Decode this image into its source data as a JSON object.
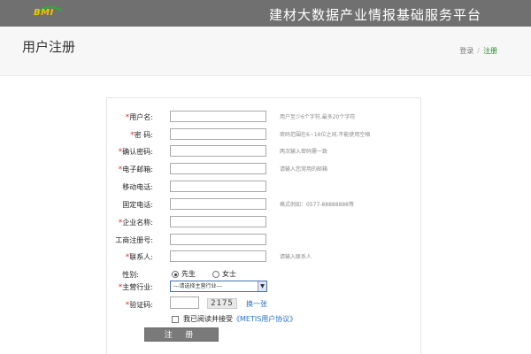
{
  "header": {
    "logo_text": "BMI",
    "site_title": "建材大数据产业情报基础服务平台"
  },
  "page": {
    "title": "用户注册",
    "breadcrumb": {
      "home": "登录",
      "separator": "/",
      "current": "注册"
    }
  },
  "form": {
    "fields": [
      {
        "label": "用户名:",
        "required": true,
        "value": "",
        "hint": "用户至少6个字符,最多20个字符"
      },
      {
        "label": "密 码:",
        "required": true,
        "value": "",
        "hint": "密码范围在6~16位之间,不能使用空格"
      },
      {
        "label": "确认密码:",
        "required": true,
        "value": "",
        "hint": "两次输入密码需一致"
      },
      {
        "label": "电子邮箱:",
        "required": true,
        "value": "",
        "hint": "请输入您常用的邮箱"
      },
      {
        "label": "移动电话:",
        "required": false,
        "value": "",
        "hint": ""
      },
      {
        "label": "固定电话:",
        "required": false,
        "value": "",
        "hint": "格式例如：0577-88888888等"
      },
      {
        "label": "企业名称:",
        "required": true,
        "value": "",
        "hint": ""
      },
      {
        "label": "工商注册号:",
        "required": false,
        "value": "",
        "hint": ""
      },
      {
        "label": "联系人:",
        "required": true,
        "value": "",
        "hint": "请输入联系人"
      }
    ],
    "gender": {
      "label": "性别:",
      "options": [
        "先生",
        "女士"
      ],
      "selected": "先生"
    },
    "industry": {
      "label": "主营行业:",
      "required": true,
      "selected": "---请选择主营行业---"
    },
    "captcha": {
      "label": "验证码:",
      "required": true,
      "code": "2175",
      "refresh_label": "换一张"
    },
    "agreement": {
      "checked": false,
      "text": "我已阅读并接受",
      "link_text": "《METIS用户协议》"
    },
    "submit_label": "注 册",
    "required_mark": "*"
  },
  "colors": {
    "topbar": "#707070",
    "logo": "#f2c200",
    "required": "#d9302f",
    "link": "#2f6fc3",
    "breadcrumb_current": "#2a8a2a",
    "submit": "#7a7a7a"
  }
}
